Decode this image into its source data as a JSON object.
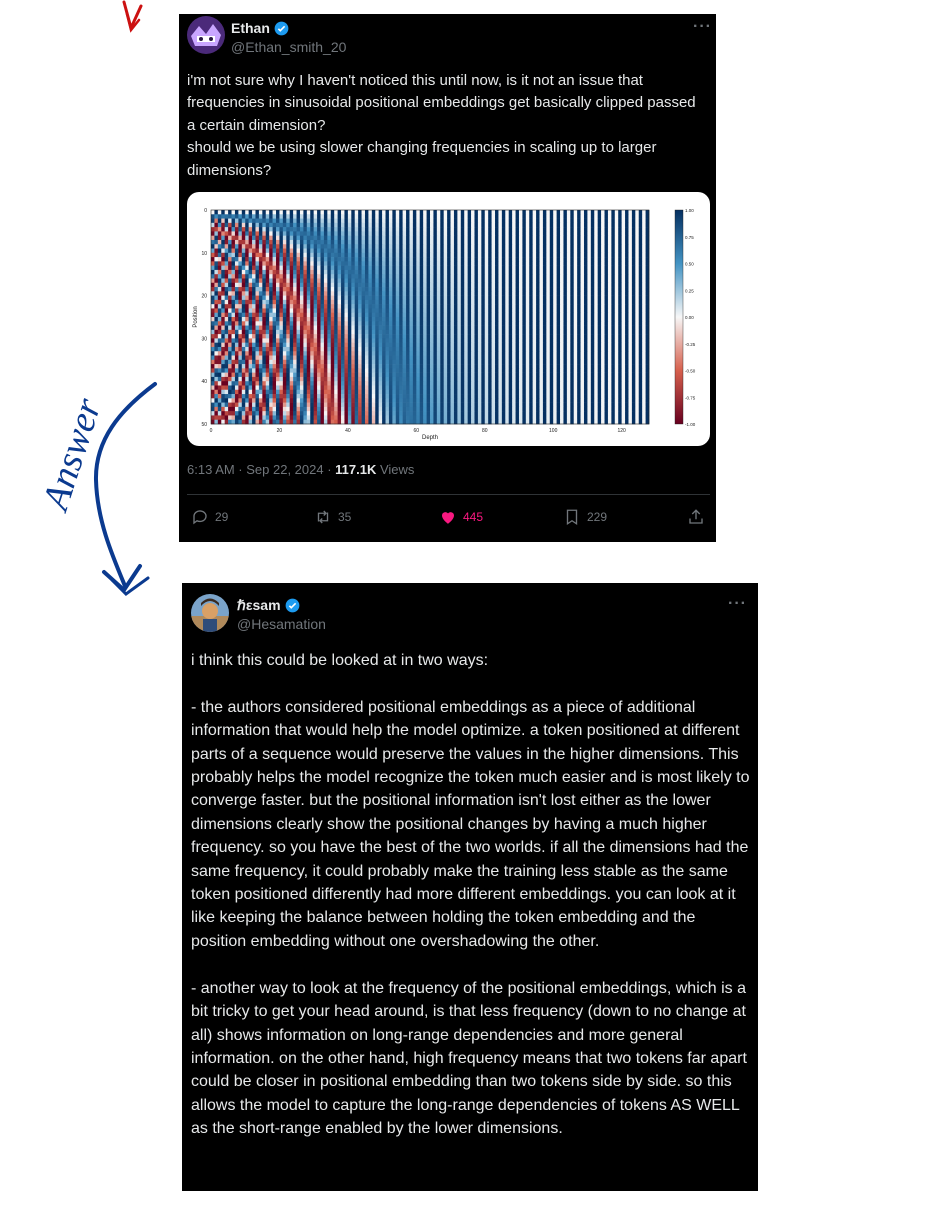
{
  "tweet1": {
    "name": "Ethan",
    "handle": "@Ethan_smith_20",
    "text": "i'm not sure why I haven't noticed this until now, is it not an issue that frequencies in sinusoidal positional embeddings get basically clipped passed a certain dimension?\nshould we be using slower changing frequencies in scaling up to larger dimensions?",
    "time": "6:13 AM · Sep 22, 2024 · ",
    "views_count": "117.1K",
    "views_label": " Views",
    "replies": "29",
    "retweets": "35",
    "likes": "445",
    "bookmarks": "229",
    "icons": [
      "reply-icon",
      "retweet-icon",
      "heart-icon",
      "bookmark-icon",
      "share-icon",
      "verified-icon",
      "more-icon"
    ]
  },
  "tweet2": {
    "name": "ℏεsam",
    "handle": "@Hesamation",
    "text": "i think this could be looked at in two ways:\n\n- the authors considered positional embeddings as a piece of additional information that would help the model optimize. a token positioned at different parts of a sequence would preserve the values in the higher dimensions. This probably helps the model recognize the token much easier and is most likely to converge faster. but the positional information isn't lost either as the lower dimensions clearly show the positional changes by having a much higher frequency. so you have the best of the two worlds. if all the dimensions had the same frequency, it could probably  make the training less stable as the same token positioned differently had more different embeddings. you can look at it like keeping the balance between holding the token embedding and the position embedding without one overshadowing the other.\n\n- another way to look at the frequency of the positional embeddings, which is a bit tricky to get your head around, is that less frequency (down to no change at all) shows information on long-range dependencies and more general information. on the other hand, high frequency means that two tokens far apart could be closer in positional embedding than two tokens side by side. so this allows the model to capture the long-range dependencies of tokens AS WELL as the short-range enabled by the lower dimensions."
  },
  "annotations": {
    "arrow_text": "Answer",
    "ink_color": "#0b3a8f",
    "top_arrow_color": "#cc1111"
  },
  "chart_data": {
    "type": "heatmap",
    "xlabel": "Depth",
    "ylabel": "Position",
    "x_ticks": [
      "0",
      "20",
      "40",
      "60",
      "80",
      "100",
      "120"
    ],
    "y_ticks": [
      "0",
      "10",
      "20",
      "30",
      "40",
      "50"
    ],
    "xlim": [
      0,
      128
    ],
    "ylim": [
      0,
      50
    ],
    "colorbar_ticks": [
      "1.00",
      "0.75",
      "0.50",
      "0.25",
      "0.00",
      "-0.25",
      "-0.50",
      "-0.75",
      "-1.00"
    ],
    "colormap": "RdBu",
    "depth": 128,
    "positions": 50
  }
}
